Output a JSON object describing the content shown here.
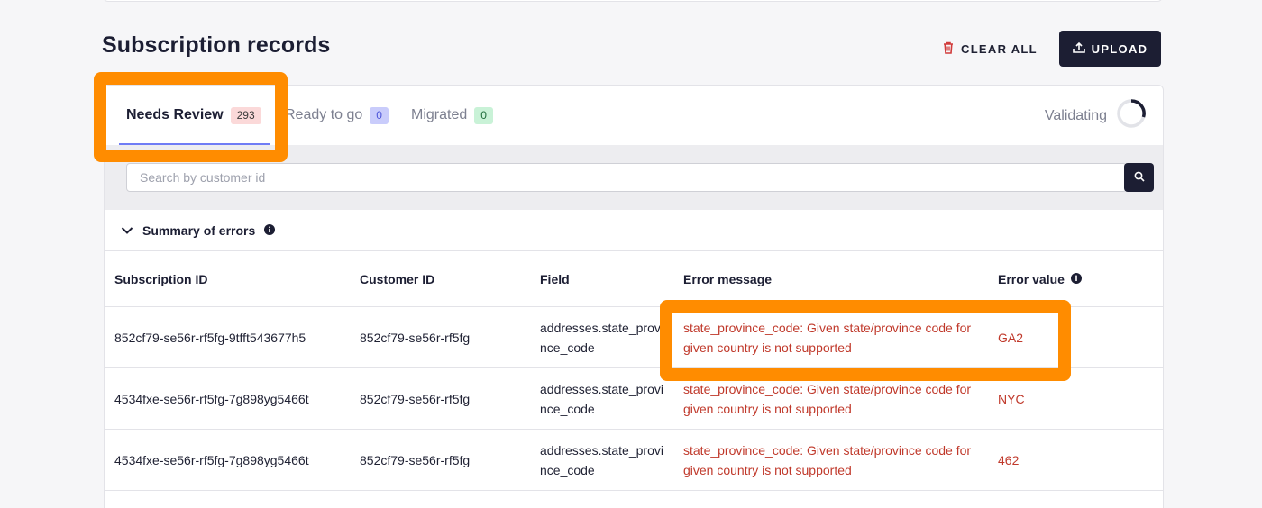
{
  "header": {
    "title": "Subscription records",
    "clear_all_label": "CLEAR ALL",
    "upload_label": "UPLOAD"
  },
  "tabs": [
    {
      "label": "Needs Review",
      "count": "293",
      "active": true
    },
    {
      "label": "Ready to go",
      "count": "0",
      "active": false
    },
    {
      "label": "Migrated",
      "count": "0",
      "active": false
    }
  ],
  "status": {
    "label": "Validating"
  },
  "search": {
    "placeholder": "Search by customer id",
    "value": ""
  },
  "summary": {
    "label": "Summary of errors"
  },
  "table": {
    "columns": [
      "Subscription ID",
      "Customer ID",
      "Field",
      "Error message",
      "Error value"
    ],
    "rows": [
      [
        "852cf79-se56r-rf5fg-9tfft543677h5",
        "852cf79-se56r-rf5fg",
        "addresses.state_province_code",
        "state_province_code: Given state/province code for given country is not supported",
        "GA2"
      ],
      [
        "4534fxe-se56r-rf5fg-7g898yg5466t",
        "852cf79-se56r-rf5fg",
        "addresses.state_province_code",
        "state_province_code: Given state/province code for given country is not supported",
        "NYC"
      ],
      [
        "4534fxe-se56r-rf5fg-7g898yg5466t",
        "852cf79-se56r-rf5fg",
        "addresses.state_province_code",
        "state_province_code: Given state/province code for given country is not supported",
        "462"
      ]
    ]
  },
  "colors": {
    "primary_dark": "#1c1e33",
    "error_text": "#c0392b",
    "tab_underline": "#6f7cf5",
    "highlight": "#ff8c00"
  },
  "icons": [
    "trash-icon",
    "upload-icon",
    "spinner-icon",
    "search-icon",
    "chevron-down-icon",
    "info-icon"
  ]
}
